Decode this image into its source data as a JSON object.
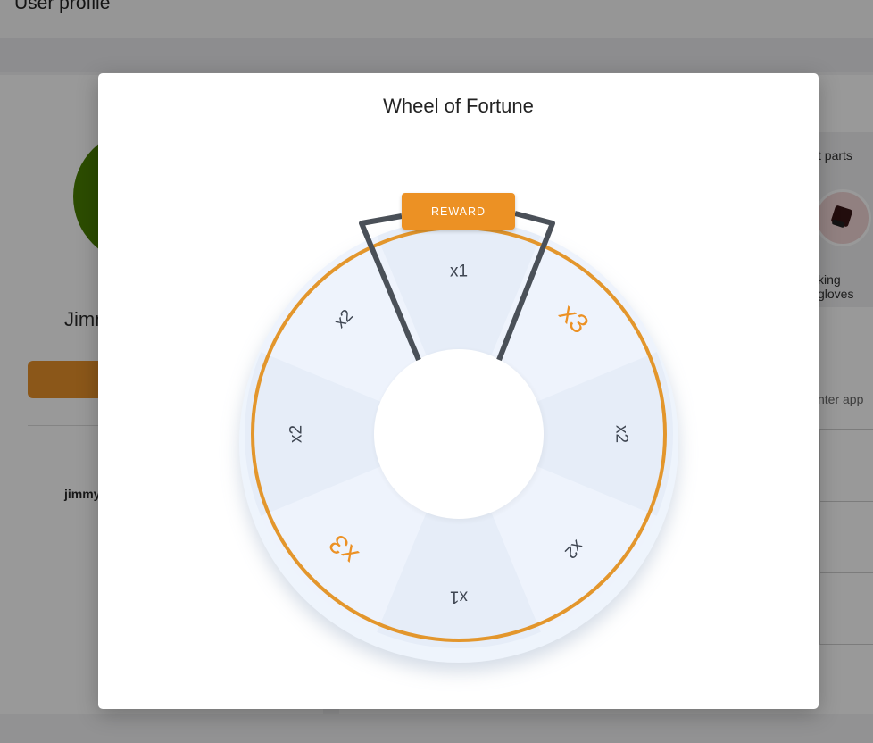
{
  "background": {
    "page_title": "User profile",
    "profile_name": "Jimm",
    "username": "jimmy",
    "parts_label": "t parts",
    "item_label": "king gloves",
    "enter_label": "nter app"
  },
  "modal": {
    "title": "Wheel of Fortune",
    "reward_button": "REWARD"
  },
  "wheel": {
    "segments": [
      {
        "label": "x1"
      },
      {
        "label": "x3"
      },
      {
        "label": "x2"
      },
      {
        "label": "x2"
      },
      {
        "label": "x1"
      },
      {
        "label": "x3"
      },
      {
        "label": "x2"
      },
      {
        "label": "x2"
      }
    ],
    "highlight_color": "#ec9124",
    "text_color": "#3f4652",
    "rim_color": "#e3962c",
    "pointer_color": "#4a5058"
  }
}
